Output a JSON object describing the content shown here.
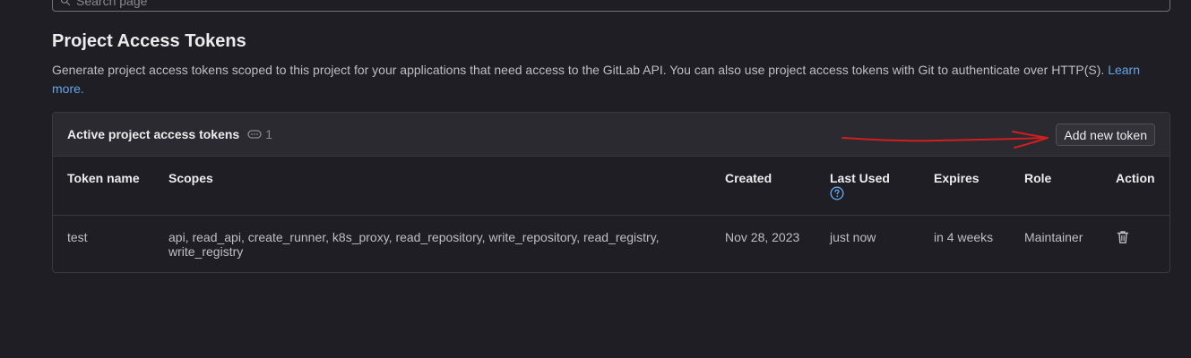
{
  "search": {
    "placeholder": "Search page"
  },
  "page": {
    "title": "Project Access Tokens",
    "description": "Generate project access tokens scoped to this project for your applications that need access to the GitLab API. You can also use project access tokens with Git to authenticate over HTTP(S).",
    "learn_more": "Learn more."
  },
  "card": {
    "title": "Active project access tokens",
    "count": "1",
    "add_button": "Add new token"
  },
  "table": {
    "headers": {
      "token_name": "Token name",
      "scopes": "Scopes",
      "created": "Created",
      "last_used": "Last Used",
      "expires": "Expires",
      "role": "Role",
      "action": "Action"
    },
    "rows": [
      {
        "token_name": "test",
        "scopes": "api, read_api, create_runner, k8s_proxy, read_repository, write_repository, read_registry, write_registry",
        "created": "Nov 28, 2023",
        "last_used": "just now",
        "expires": "in 4 weeks",
        "role": "Maintainer"
      }
    ]
  },
  "colors": {
    "background": "#1f1e24",
    "card_header": "#2b2a30",
    "link": "#63a6e9",
    "annotation": "#d11f1f"
  },
  "icons": {
    "search": "search-icon",
    "token_count": "token-icon",
    "help": "question-circle-icon",
    "delete": "trash-icon"
  }
}
